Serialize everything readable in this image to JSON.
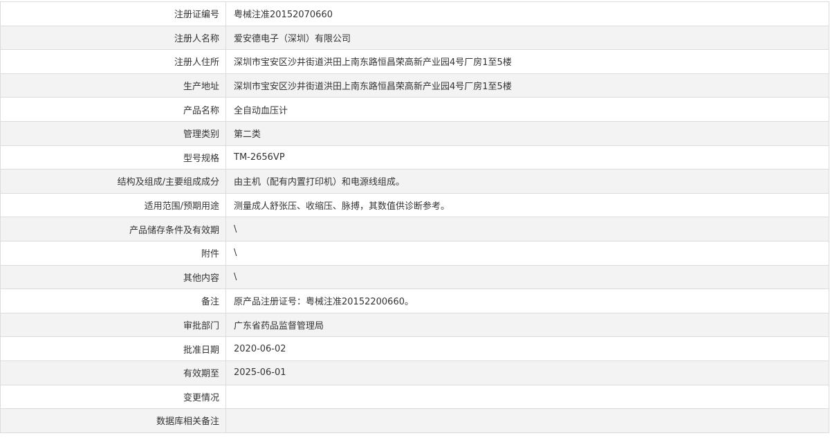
{
  "record": {
    "rows": [
      {
        "label": "注册证编号",
        "value": "粤械注准20152070660"
      },
      {
        "label": "注册人名称",
        "value": "爱安德电子（深圳）有限公司"
      },
      {
        "label": "注册人住所",
        "value": "深圳市宝安区沙井街道洪田上南东路恒昌荣高新产业园4号厂房1至5楼"
      },
      {
        "label": "生产地址",
        "value": "深圳市宝安区沙井街道洪田上南东路恒昌荣高新产业园4号厂房1至5楼"
      },
      {
        "label": "产品名称",
        "value": "全自动血压计"
      },
      {
        "label": "管理类别",
        "value": "第二类"
      },
      {
        "label": "型号规格",
        "value": "TM-2656VP"
      },
      {
        "label": "结构及组成/主要组成成分",
        "value": "由主机（配有内置打印机）和电源线组成。"
      },
      {
        "label": "适用范围/预期用途",
        "value": "测量成人舒张压、收缩压、脉搏，其数值供诊断参考。"
      },
      {
        "label": "产品储存条件及有效期",
        "value": "\\"
      },
      {
        "label": "附件",
        "value": "\\"
      },
      {
        "label": "其他内容",
        "value": "\\"
      },
      {
        "label": "备注",
        "value": "原产品注册证号：粤械注准20152200660。"
      },
      {
        "label": "审批部门",
        "value": "广东省药品监督管理局"
      },
      {
        "label": "批准日期",
        "value": "2020-06-02"
      },
      {
        "label": "有效期至",
        "value": "2025-06-01"
      },
      {
        "label": "变更情况",
        "value": ""
      },
      {
        "label": "数据库相关备注",
        "value": ""
      }
    ]
  }
}
